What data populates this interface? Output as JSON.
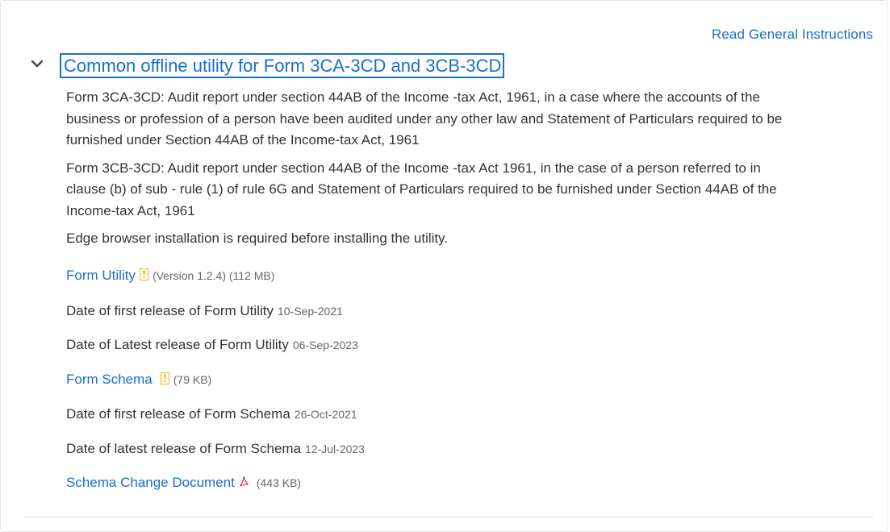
{
  "header": {
    "read_instructions_label": "Read General Instructions"
  },
  "section": {
    "title": "Common offline utility for Form 3CA-3CD and 3CB-3CD",
    "descriptions": [
      "Form 3CA-3CD: Audit report under section 44AB of the Income -tax Act, 1961, in a case where the accounts of the business or profession of a person have been audited under any other law and Statement of Particulars required to be furnished under Section 44AB of the Income-tax Act, 1961",
      "Form 3CB-3CD: Audit report under section 44AB of the Income -tax Act 1961, in the case of a person referred to in clause (b) of sub - rule (1) of rule 6G and Statement of Particulars required to be furnished under Section 44AB of the Income-tax Act, 1961",
      "Edge browser installation is required before installing the utility."
    ]
  },
  "downloads": {
    "form_utility": {
      "label": "Form Utility",
      "meta": "(Version 1.2.4) (112 MB)",
      "icon": "zip-file-icon"
    },
    "utility_first_release": {
      "label": "Date of first release of Form Utility",
      "date": "10-Sep-2021"
    },
    "utility_latest_release": {
      "label": "Date of Latest release of Form Utility",
      "date": "06-Sep-2023"
    },
    "form_schema": {
      "label": "Form Schema",
      "meta": "(79 KB)",
      "icon": "zip-file-icon"
    },
    "schema_first_release": {
      "label": "Date of first release of Form Schema",
      "date": "26-Oct-2021"
    },
    "schema_latest_release": {
      "label": "Date of latest release of Form Schema",
      "date": "12-Jul-2023"
    },
    "schema_change_doc": {
      "label": "Schema Change Document",
      "meta": "(443 KB)",
      "icon": "pdf-file-icon"
    }
  },
  "colors": {
    "link": "#1a6fcb",
    "text": "#333333",
    "meta": "#666666",
    "zip_icon": "#f0b400",
    "pdf_icon": "#e02020"
  }
}
